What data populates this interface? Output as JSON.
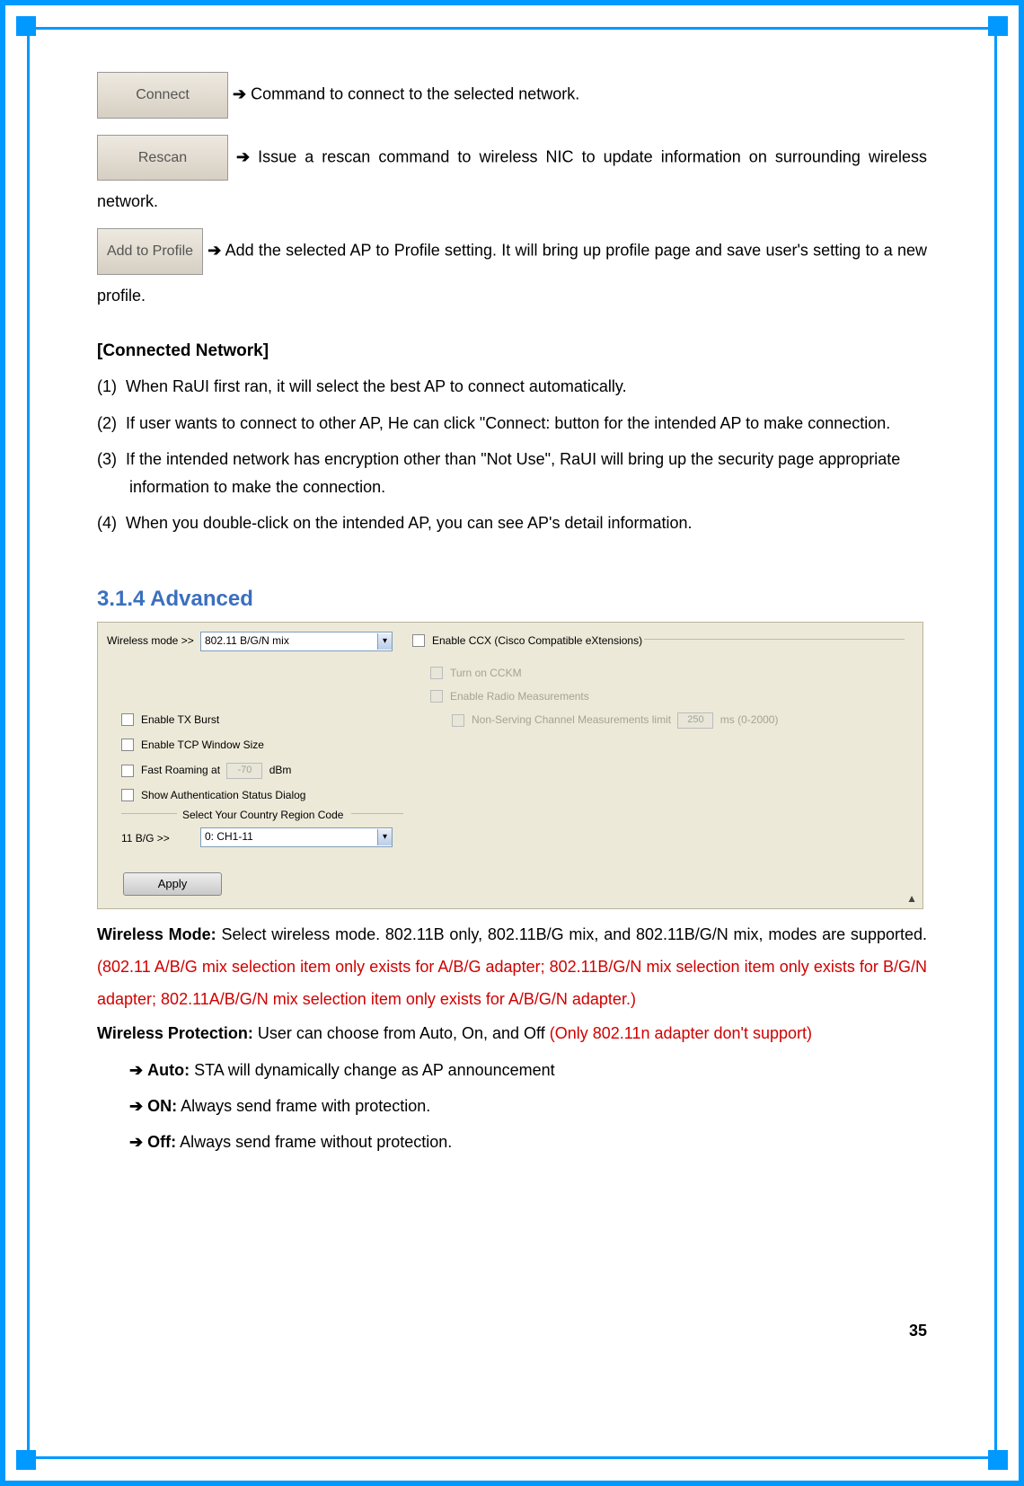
{
  "buttons": {
    "connect": "Connect",
    "rescan": "Rescan",
    "add_to_profile": "Add to Profile"
  },
  "desc": {
    "connect": " Command to connect to the selected network.",
    "rescan": " Issue a rescan command to wireless NIC to update information on surrounding wireless network.",
    "add_to_profile": " Add the selected AP to Profile setting. It will bring up profile page and save user's setting to a new profile."
  },
  "connected": {
    "header": "[Connected Network]",
    "items": [
      "When RaUI first ran, it will select the best AP to connect automatically.",
      "If user wants to connect to other AP, He can click \"Connect: button for the intended AP to make connection.",
      "If the intended network has encryption other than \"Not Use\", RaUI will bring up the security page appropriate information to make the connection.",
      "When you double-click on the intended AP, you can see AP's detail information."
    ]
  },
  "section_title": "3.1.4  Advanced",
  "screenshot": {
    "wireless_mode_label": "Wireless mode >>",
    "wireless_mode_value": "802.11 B/G/N mix",
    "enable_ccx": "Enable CCX (Cisco Compatible eXtensions)",
    "turn_cckm": "Turn on CCKM",
    "enable_radio": "Enable Radio Measurements",
    "nonserving": "Non-Serving Channel Measurements limit",
    "nonserving_val": "250",
    "nonserving_suffix": "ms (0-2000)",
    "enable_txburst": "Enable TX Burst",
    "enable_tcp": "Enable TCP Window Size",
    "fast_roaming": "Fast Roaming at",
    "fast_roaming_val": "-70",
    "fast_roaming_suffix": "dBm",
    "show_auth": "Show Authentication Status Dialog",
    "region_label": "Select Your Country Region Code",
    "eleven_bg": "11 B/G >>",
    "region_val": "0: CH1-11",
    "apply": "Apply"
  },
  "body": {
    "wireless_mode_bold": "Wireless Mode:",
    "wireless_mode_text": " Select wireless mode. 802.11B only, 802.11B/G mix, and 802.11B/G/N mix, modes are supported. ",
    "wireless_mode_red": "(802.11 A/B/G mix selection item only exists for A/B/G adapter; 802.11B/G/N mix selection item only exists for B/G/N adapter; 802.11A/B/G/N mix selection item only exists for A/B/G/N adapter.)",
    "wireless_prot_bold": "Wireless Protection:",
    "wireless_prot_text": " User can choose from Auto, On, and Off ",
    "wireless_prot_red": "(Only 802.11n adapter don't support)",
    "auto_bold": "Auto:",
    "auto_text": " STA will dynamically change as AP announcement",
    "on_bold": "ON:",
    "on_text": " Always send frame with protection.",
    "off_bold": "Off:",
    "off_text": " Always send frame without protection."
  },
  "arrow": "➔",
  "page_number": "35"
}
